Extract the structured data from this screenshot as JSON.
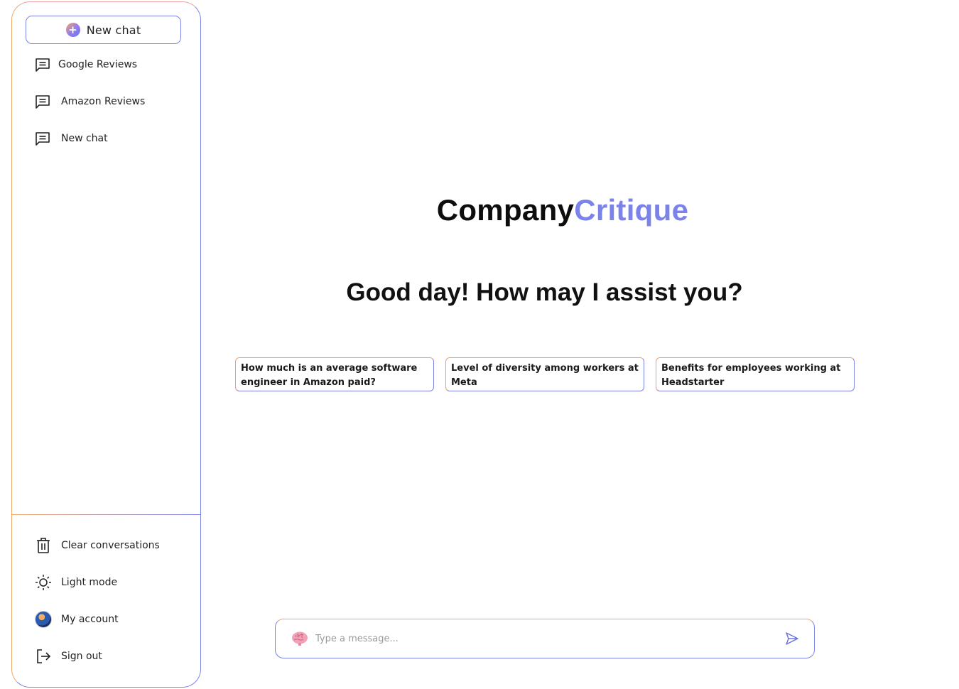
{
  "sidebar": {
    "new_chat_label": "New chat",
    "chats": [
      {
        "label": "Google Reviews",
        "icon": "chat-icon"
      },
      {
        "label": "Amazon Reviews",
        "icon": "chat-icon"
      },
      {
        "label": "New chat",
        "icon": "chat-icon"
      }
    ],
    "bottom": [
      {
        "label": "Clear conversations",
        "icon": "trash-icon"
      },
      {
        "label": "Light mode",
        "icon": "sun-icon"
      },
      {
        "label": "My account",
        "icon": "avatar"
      },
      {
        "label": "Sign out",
        "icon": "sign-out-icon"
      }
    ]
  },
  "main": {
    "brand_part1": "Company",
    "brand_part2": "Critique",
    "greeting": "Good day! How may I assist you?",
    "suggestions": [
      "How much is an average software engineer in Amazon paid?",
      "Level of diversity among workers at Meta",
      "Benefits for employees working at Headstarter"
    ],
    "composer": {
      "placeholder": "Type a message...",
      "value": ""
    }
  },
  "colors": {
    "accent": "#7b83e8",
    "accent_warm": "#f0a86a"
  }
}
